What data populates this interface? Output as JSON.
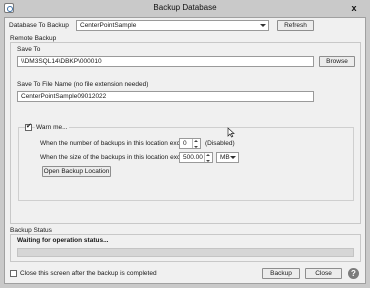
{
  "window": {
    "title": "Backup Database",
    "close_label": "x"
  },
  "database": {
    "label": "Database To Backup",
    "selected": "CenterPointSample",
    "refresh_label": "Refresh"
  },
  "remote_backup": {
    "group_label": "Remote Backup",
    "save_to_label": "Save To",
    "save_to_value": "\\\\DM3SQL14\\DBKP\\000010",
    "browse_label": "Browse",
    "file_name_label": "Save To File Name (no file extension needed)",
    "file_name_value": "CenterPointSample09012022"
  },
  "warn": {
    "label": "Warn me...",
    "checked": true,
    "count_label": "When the number of backups in this location exceeds",
    "count_value": "0",
    "count_note": "(Disabled)",
    "size_label": "When the size of the backups in this location exceeds",
    "size_value": "500.00",
    "size_unit": "MB",
    "open_location_label": "Open Backup Location"
  },
  "status": {
    "group_label": "Backup Status",
    "text": "Waiting for operation status...",
    "progress": 0
  },
  "footer": {
    "close_after_label": "Close this screen after the backup is completed",
    "close_after_checked": false,
    "backup_label": "Backup",
    "close_label": "Close"
  },
  "icons": {
    "app": "database-app-icon",
    "help": "help-icon",
    "cursor": "mouse-pointer-icon"
  }
}
